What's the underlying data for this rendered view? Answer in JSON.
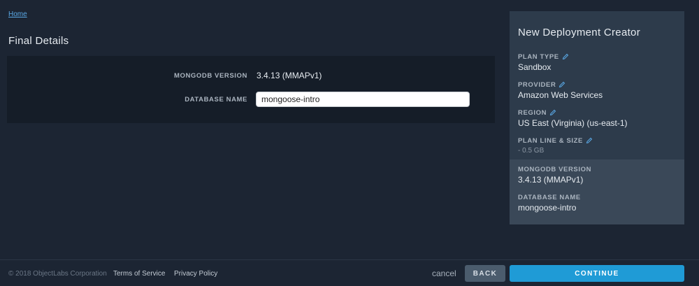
{
  "breadcrumb": {
    "home_label": "Home"
  },
  "page": {
    "title": "Final Details"
  },
  "form": {
    "mongodb_version_label": "MONGODB VERSION",
    "mongodb_version_value": "3.4.13 (MMAPv1)",
    "database_name_label": "DATABASE NAME",
    "database_name_value": "mongoose-intro"
  },
  "sidebar": {
    "title": "New Deployment Creator",
    "plan_type_label": "PLAN TYPE",
    "plan_type_value": "Sandbox",
    "provider_label": "PROVIDER",
    "provider_value": "Amazon Web Services",
    "region_label": "REGION",
    "region_value": "US East (Virginia) (us-east-1)",
    "plan_line_label": "PLAN LINE & SIZE",
    "plan_line_value": "- 0.5 GB",
    "mongodb_version_label": "MONGODB VERSION",
    "mongodb_version_value": "3.4.13 (MMAPv1)",
    "database_name_label": "DATABASE NAME",
    "database_name_value": "mongoose-intro",
    "edit_icon": "pencil-icon"
  },
  "footer": {
    "copyright": "© 2018 ObjectLabs Corporation",
    "terms_label": "Terms of Service",
    "privacy_label": "Privacy Policy",
    "cancel_label": "cancel",
    "back_label": "BACK",
    "continue_label": "CONTINUE"
  },
  "colors": {
    "background": "#1c2533",
    "panel": "#151d28",
    "sidebar": "#2d3b4b",
    "accent": "#1f9bd6",
    "link": "#5aa9e6"
  }
}
